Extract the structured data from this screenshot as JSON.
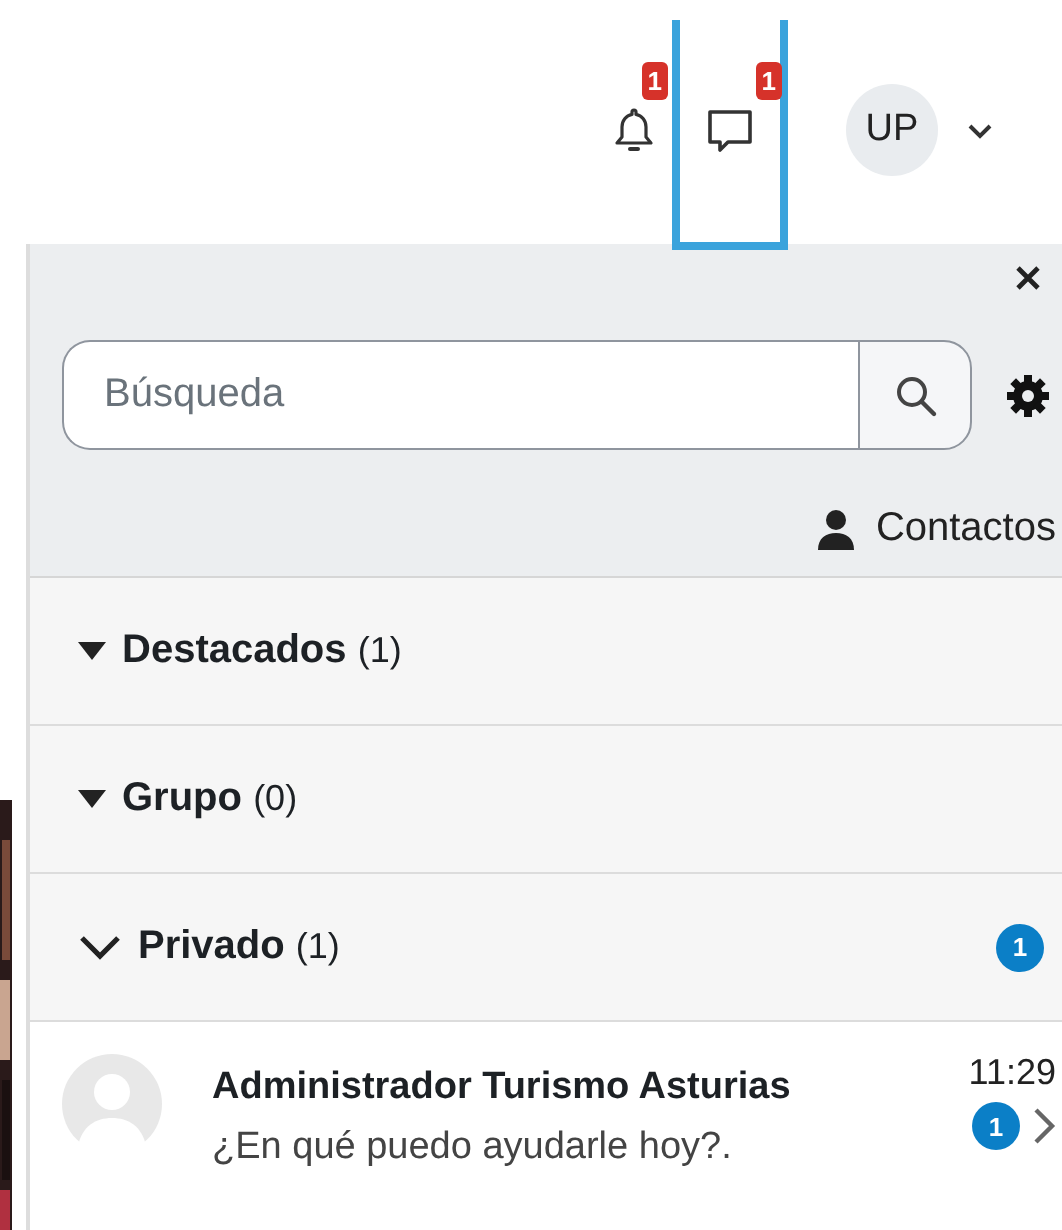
{
  "header": {
    "notifications": {
      "badge": "1"
    },
    "messages": {
      "badge": "1",
      "selected": true
    },
    "user": {
      "initials": "UP"
    }
  },
  "panel": {
    "search": {
      "placeholder": "Búsqueda"
    },
    "contacts_link": "Contactos",
    "sections": [
      {
        "label": "Destacados",
        "count": "(1)",
        "expanded": false
      },
      {
        "label": "Grupo",
        "count": "(0)",
        "expanded": false
      },
      {
        "label": "Privado",
        "count": "(1)",
        "expanded": true,
        "unread": "1"
      }
    ],
    "conversations": [
      {
        "name": "Administrador Turismo Asturias",
        "preview": "¿En qué puedo ayudarle hoy?.",
        "time": "11:29",
        "unread": "1"
      }
    ]
  }
}
